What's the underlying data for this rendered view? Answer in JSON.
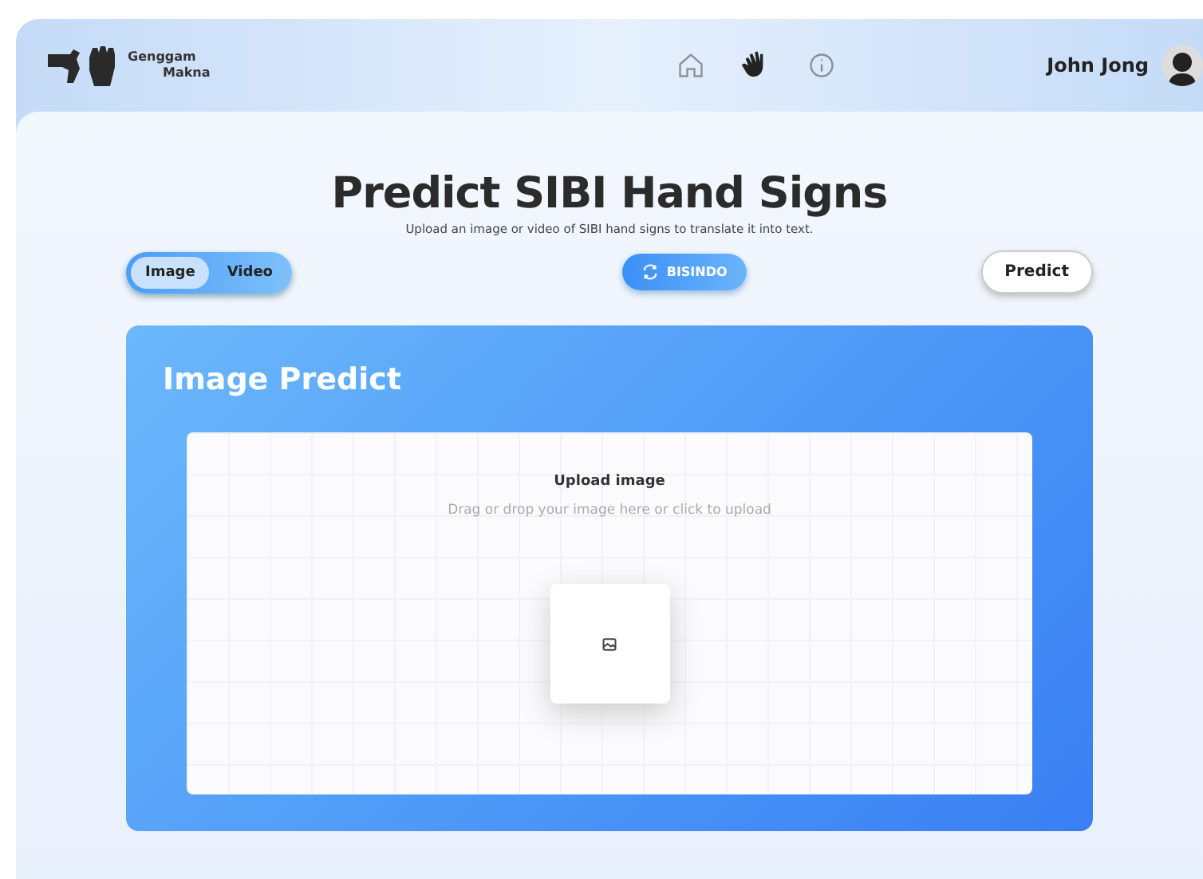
{
  "header": {
    "logo": {
      "line_1": "Genggam",
      "line_2": "Makna"
    },
    "nav": [
      {
        "kind": "home",
        "selected": false
      },
      {
        "kind": "hand",
        "selected": true
      },
      {
        "kind": "info",
        "selected": false
      }
    ],
    "user": {
      "name": "John Jong"
    }
  },
  "page": {
    "title": "Predict SIBI Hand Signs",
    "subtitle": "Upload an image or video of SIBI hand signs to translate it into text."
  },
  "media_toggle": [
    {
      "label": "Image",
      "selected": true
    },
    {
      "label": "Video",
      "selected": false
    }
  ],
  "switch_button": {
    "label": "BISINDO"
  },
  "predict_button": {
    "label": "Predict"
  },
  "card": {
    "title": "Image Predict",
    "upload": {
      "title": "Upload image",
      "hint": "Drag or drop your image here or click to upload"
    }
  }
}
